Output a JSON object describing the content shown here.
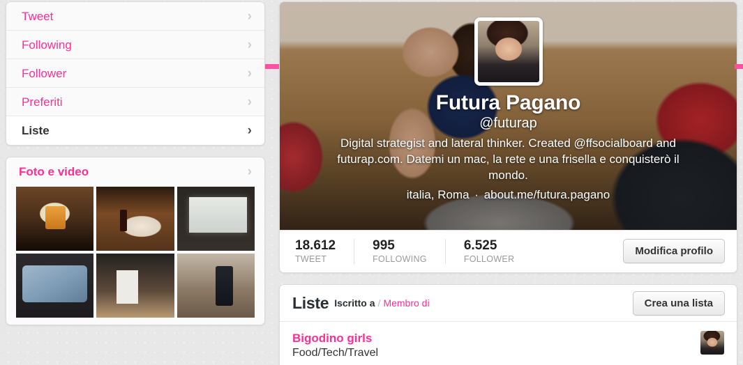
{
  "sidebar": {
    "nav": [
      {
        "label": "Tweet",
        "active": false
      },
      {
        "label": "Following",
        "active": false
      },
      {
        "label": "Follower",
        "active": false
      },
      {
        "label": "Preferiti",
        "active": false
      },
      {
        "label": "Liste",
        "active": true
      }
    ],
    "photos": {
      "title": "Foto e video",
      "chevron": "›",
      "tiles": [
        "tv-screen-photo",
        "dinner-table-photo",
        "presentation-screen-photo",
        "twitter-laptop-photo",
        "studio-shoot-photo",
        "smartwatch-phone-photo"
      ]
    },
    "chevron": "›"
  },
  "profile": {
    "full_name": "Futura Pagano",
    "handle": "@futurap",
    "bio": "Digital strategist and lateral thinker. Created @ffsocialboard and futurap.com. Datemi un mac, la rete e una frisella e conquisterò il mondo.",
    "location": "italia, Roma",
    "separator": "·",
    "website": "about.me/futura.pagano",
    "avatar_alt": "futura-pagano-avatar",
    "stats": [
      {
        "value": "18.612",
        "label": "TWEET"
      },
      {
        "value": "995",
        "label": "FOLLOWING"
      },
      {
        "value": "6.525",
        "label": "FOLLOWER"
      }
    ],
    "edit_button": "Modifica profilo"
  },
  "lists": {
    "title": "Liste",
    "tab_active": "Iscritto a",
    "tab_separator": "/",
    "tab_inactive": "Membro di",
    "create_button": "Crea una lista",
    "items": [
      {
        "name": "Bigodino girls",
        "description": "Food/Tech/Travel",
        "avatar_alt": "bigodino-girls-avatar"
      }
    ]
  },
  "colors": {
    "accent_pink": "#ff2e95",
    "rule_pink": "#ff4fa3",
    "text_dark": "#292f33",
    "muted_gray": "#9a9a9a",
    "page_bg": "#e8e8e8"
  }
}
